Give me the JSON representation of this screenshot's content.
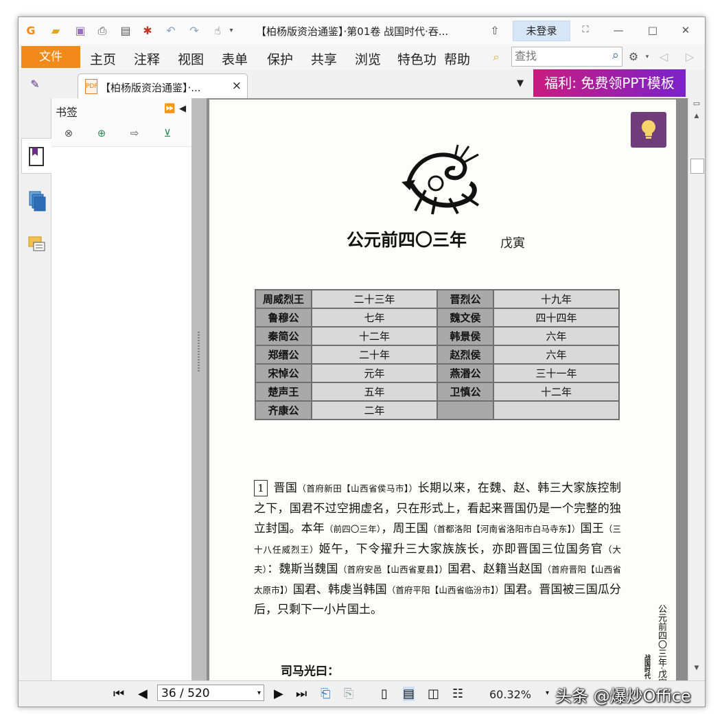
{
  "window": {
    "title": "【柏杨版资治通鉴】·第01卷 战国时代·吞...",
    "login_label": "未登录"
  },
  "menu": {
    "file": "文件",
    "items": [
      "主页",
      "注释",
      "视图",
      "表单",
      "保护",
      "共享",
      "浏览",
      "特色功",
      "帮助"
    ]
  },
  "search": {
    "placeholder": "查找"
  },
  "tabs": [
    {
      "label": "【柏杨版资治通鉴】·...",
      "close": "×"
    }
  ],
  "promo": {
    "label": "福利: 免费领PPT模板"
  },
  "bookmark_panel": {
    "title": "书签"
  },
  "document": {
    "title": "公元前四〇三年",
    "ganzhi": "戊寅",
    "rulers_table": [
      [
        "周威烈王",
        "二十三年",
        "晋烈公",
        "十九年"
      ],
      [
        "鲁穆公",
        "七年",
        "魏文侯",
        "四十四年"
      ],
      [
        "秦简公",
        "十二年",
        "韩景侯",
        "六年"
      ],
      [
        "郑缙公",
        "二十年",
        "赵烈侯",
        "六年"
      ],
      [
        "宋悼公",
        "元年",
        "燕湣公",
        "三十一年"
      ],
      [
        "楚声王",
        "五年",
        "卫慎公",
        "十二年"
      ],
      [
        "齐康公",
        "二年",
        "",
        ""
      ]
    ],
    "paragraph_number": "1",
    "paragraph": [
      {
        "t": "晋国"
      },
      {
        "t": "（首府新田【山西省侯马市】）",
        "note": true
      },
      {
        "t": "长期以来，在魏、赵、韩三大家族控制之下，国君不过空拥虚名，只在形式上，看起来晋国仍是一个完整的独立封国。本年"
      },
      {
        "t": "（前四〇三年）",
        "note": true
      },
      {
        "t": "，周王国"
      },
      {
        "t": "（首都洛阳【河南省洛阳市白马寺东】）",
        "note": true
      },
      {
        "t": "国王"
      },
      {
        "t": "（三十八任威烈王）",
        "note": true
      },
      {
        "t": "姬午，下令擢升三大家族族长，亦即晋国三位国务官"
      },
      {
        "t": "（大夫）",
        "note": true
      },
      {
        "t": "：魏斯当魏国"
      },
      {
        "t": "（首府安邑【山西省夏县】）",
        "note": true
      },
      {
        "t": "国君、赵籍当赵国"
      },
      {
        "t": "（首府晋阳【山西省太原市】）",
        "note": true
      },
      {
        "t": "国君、韩虔当韩国"
      },
      {
        "t": "（首府平阳【山西省临汾市】）",
        "note": true
      },
      {
        "t": "国君。晋国被三国瓜分后，只剩下一小片国土。"
      }
    ],
    "sima_heading": "司马光曰：",
    "side_header": "公元前四〇三年·戊寅",
    "side_header_small": "战国时代"
  },
  "statusbar": {
    "page_indicator": "36 / 520",
    "zoom": "60.32%"
  },
  "watermark": "头条 @爆炒Office",
  "colors": {
    "accent_orange": "#f28a1a",
    "promo_from": "#c91c7f",
    "promo_to": "#7a22c9",
    "tip_purple": "#6e3d7a"
  }
}
